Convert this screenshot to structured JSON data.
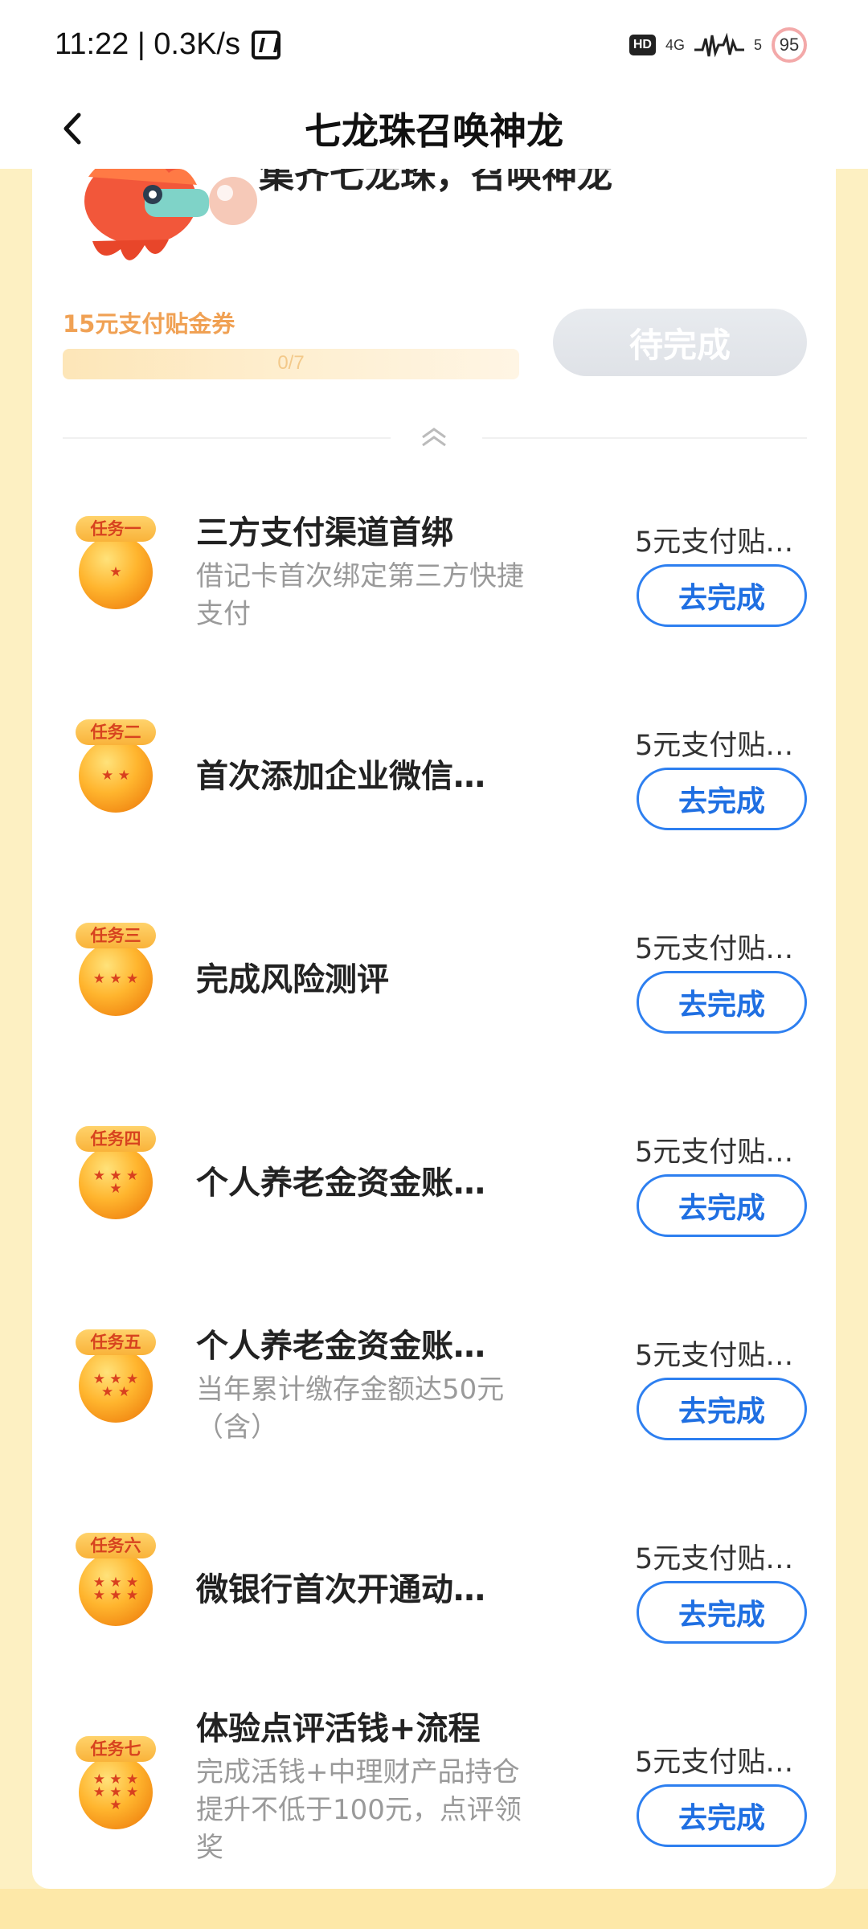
{
  "status_bar": {
    "time_speed": "11:22 | 0.3K/s",
    "hd": "HD",
    "network": "4G",
    "sim": "5",
    "battery": "95"
  },
  "nav": {
    "title": "七龙珠召唤神龙"
  },
  "header": {
    "slogan": "集齐七龙珠，召唤神龙",
    "reward_label": "15元支付贴金券",
    "progress_text": "0/7",
    "progress_fraction": 0,
    "pending_button": "待完成"
  },
  "tasks": [
    {
      "tag": "任务一",
      "stars": "★",
      "title": "三方支付渠道首绑",
      "desc": "借记卡首次绑定第三方快捷支付",
      "reward": "5元支付贴…",
      "button": "去完成"
    },
    {
      "tag": "任务二",
      "stars": "★ ★",
      "title": "首次添加企业微信…",
      "desc": "",
      "reward": "5元支付贴…",
      "button": "去完成"
    },
    {
      "tag": "任务三",
      "stars": "★ ★ ★",
      "title": "完成风险测评",
      "desc": "",
      "reward": "5元支付贴…",
      "button": "去完成"
    },
    {
      "tag": "任务四",
      "stars": "★ ★ ★ ★",
      "title": "个人养老金资金账…",
      "desc": "",
      "reward": "5元支付贴…",
      "button": "去完成"
    },
    {
      "tag": "任务五",
      "stars": "★ ★ ★ ★ ★",
      "title": "个人养老金资金账…",
      "desc": "当年累计缴存金额达50元（含）",
      "reward": "5元支付贴…",
      "button": "去完成"
    },
    {
      "tag": "任务六",
      "stars": "★ ★ ★ ★ ★ ★",
      "title": "微银行首次开通动…",
      "desc": "",
      "reward": "5元支付贴…",
      "button": "去完成"
    },
    {
      "tag": "任务七",
      "stars": "★ ★ ★ ★ ★ ★ ★",
      "title": "体验点评活钱+流程",
      "desc": "完成活钱+中理财产品持仓提升不低于100元，点评领奖",
      "reward": "5元支付贴…",
      "button": "去完成"
    }
  ]
}
